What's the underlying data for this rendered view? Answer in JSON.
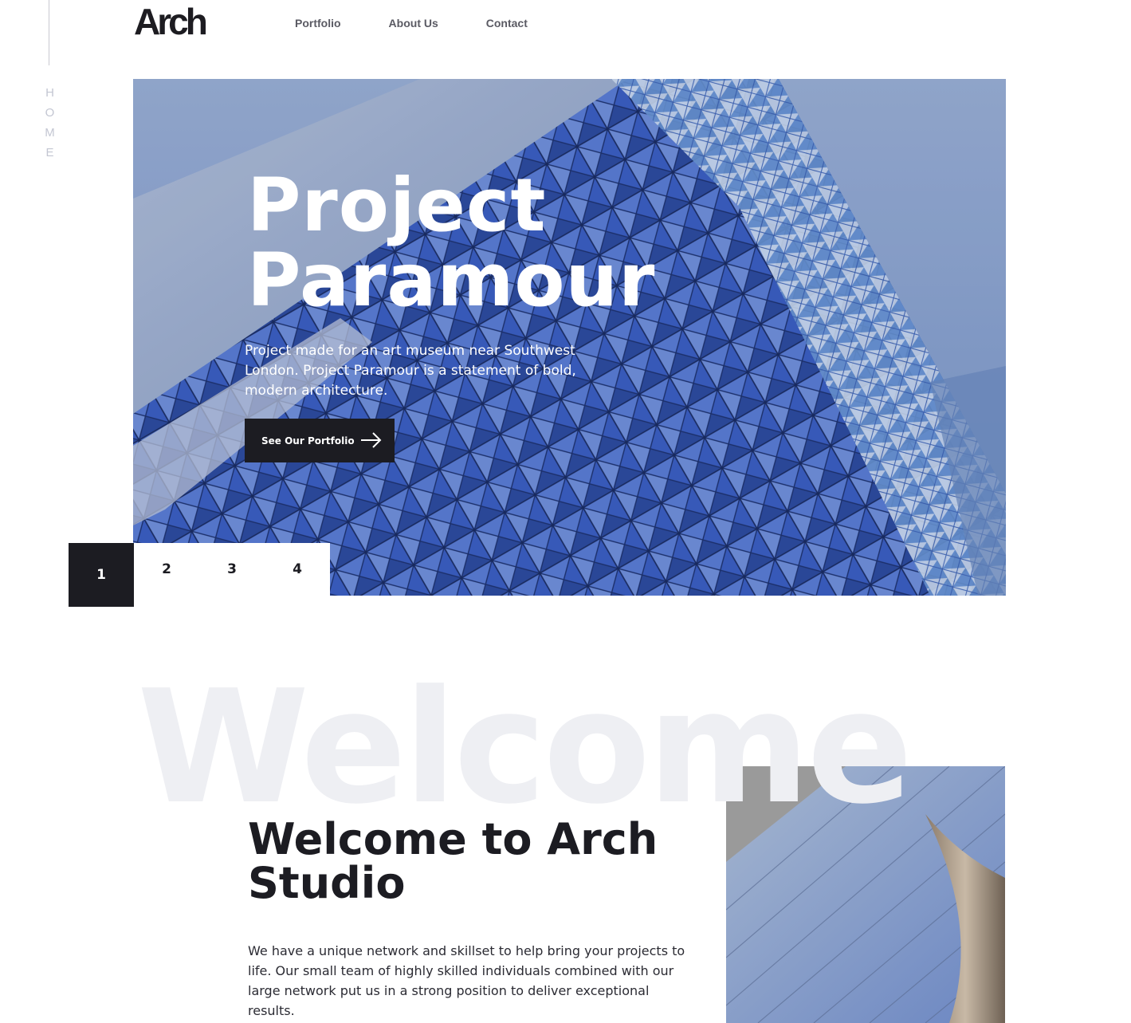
{
  "side_rail": {
    "label": "HOME"
  },
  "header": {
    "logo": "Arch",
    "nav": [
      {
        "label": "Portfolio"
      },
      {
        "label": "About Us"
      },
      {
        "label": "Contact"
      }
    ]
  },
  "hero": {
    "title_line1": "Project",
    "title_line2": "Paramour",
    "description": "Project made for an art museum near Southwest London. Project Paramour is a statement of bold, modern architecture.",
    "button_label": "See Our Portfolio",
    "button_icon": "arrow-right-icon"
  },
  "pager": {
    "pages": [
      "1",
      "2",
      "3",
      "4"
    ],
    "active": "1"
  },
  "welcome": {
    "watermark": "Welcome",
    "title": "Welcome to Arch Studio",
    "text": "We have a unique network and skillset to help bring your projects to life. Our small team of highly skilled individuals combined with our large network put us in a strong position to deliver exceptional results."
  },
  "colors": {
    "dark": "#1c1c22",
    "watermark": "#eeeff3",
    "nav_text": "#5a5a63",
    "hero_blue": "#3a5bb8"
  }
}
